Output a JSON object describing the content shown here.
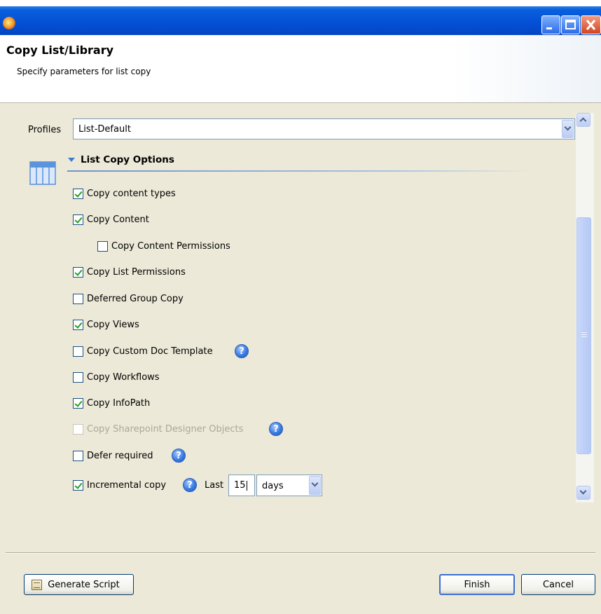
{
  "window": {
    "title": "",
    "controls": [
      "minimize-icon",
      "maximize-icon",
      "close-icon"
    ],
    "colors": {
      "titlebar": "#0550d6",
      "close": "#d4431d"
    }
  },
  "header": {
    "title": "Copy List/Library",
    "subtitle": "Specify parameters for list copy"
  },
  "profiles": {
    "label": "Profiles",
    "selected": "List-Default"
  },
  "section": {
    "title": "List Copy Options",
    "icon": "table-icon"
  },
  "options": [
    {
      "label": "Copy content types",
      "checked": true,
      "enabled": true,
      "help": false
    },
    {
      "label": "Copy Content",
      "checked": true,
      "enabled": true,
      "help": false
    },
    {
      "label": "Copy Content Permissions",
      "checked": false,
      "enabled": true,
      "help": false
    },
    {
      "label": "Copy List Permissions",
      "checked": true,
      "enabled": true,
      "help": false
    },
    {
      "label": "Deferred Group Copy",
      "checked": false,
      "enabled": true,
      "help": false
    },
    {
      "label": "Copy Views",
      "checked": true,
      "enabled": true,
      "help": false
    },
    {
      "label": "Copy Custom Doc Template",
      "checked": false,
      "enabled": true,
      "help": true
    },
    {
      "label": "Copy Workflows",
      "checked": false,
      "enabled": true,
      "help": false
    },
    {
      "label": "Copy InfoPath",
      "checked": true,
      "enabled": true,
      "help": false
    },
    {
      "label": "Copy Sharepoint Designer Objects",
      "checked": false,
      "enabled": false,
      "help": true
    },
    {
      "label": "Defer required",
      "checked": false,
      "enabled": true,
      "help": true
    }
  ],
  "incremental": {
    "label": "Incremental copy",
    "checked": true,
    "last_label": "Last",
    "value": "15",
    "unit": "days"
  },
  "help_glyph": "?",
  "buttons": {
    "generate_script": "Generate Script",
    "finish": "Finish",
    "cancel": "Cancel"
  }
}
